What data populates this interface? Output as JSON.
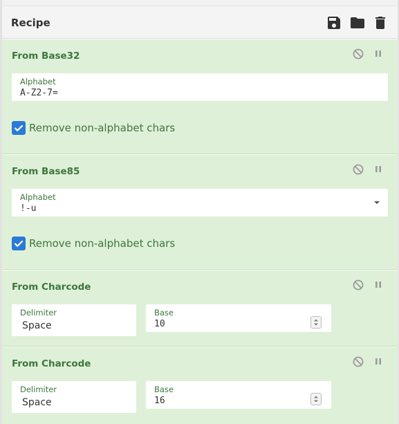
{
  "recipe": {
    "title": "Recipe",
    "icons": [
      "save-icon",
      "folder-icon",
      "trash-icon"
    ]
  },
  "operations": [
    {
      "title": "From Base32",
      "field_label": "Alphabet",
      "field_value": "A-Z2-7=",
      "checkbox_label": "Remove non-alphabet chars",
      "checked": true
    },
    {
      "title": "From Base85",
      "field_label": "Alphabet",
      "field_value": "!-u",
      "checkbox_label": "Remove non-alphabet chars",
      "checked": true
    },
    {
      "title": "From Charcode",
      "delimiter_label": "Delimiter",
      "delimiter_value": "Space",
      "base_label": "Base",
      "base_value": "10"
    },
    {
      "title": "From Charcode",
      "delimiter_label": "Delimiter",
      "delimiter_value": "Space",
      "base_label": "Base",
      "base_value": "16"
    }
  ],
  "colors": {
    "op_background": "#dff0d8",
    "op_text": "#3c763d",
    "checkbox": "#2b7ad6"
  }
}
